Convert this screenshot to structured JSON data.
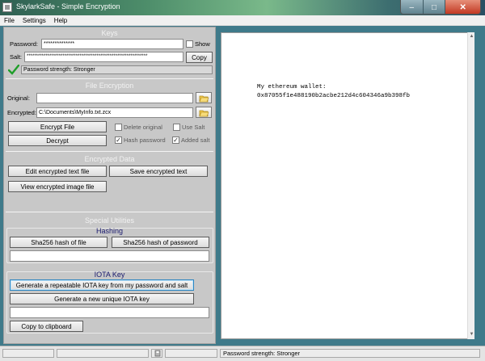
{
  "window": {
    "title": "SkylarkSafe - Simple Encryption",
    "controls": {
      "minimize": "–",
      "maximize": "□",
      "close": "✕"
    }
  },
  "menu": [
    "File",
    "Settings",
    "Help"
  ],
  "keys": {
    "title": "Keys",
    "password_label": "Password:",
    "password_value": "**************",
    "show_label": "Show",
    "salt_label": "Salt:",
    "salt_value": "****************************************************************",
    "copy_button": "Copy",
    "strength_text": "Password strength: Stronger"
  },
  "file_encryption": {
    "title": "File Encryption",
    "original_label": "Original:",
    "original_value": "",
    "encrypted_label": "Encrypted:",
    "encrypted_value": "C:\\Documents\\MyInfo.txt.zcx",
    "encrypt_button": "Encrypt File",
    "decrypt_button": "Decrypt",
    "delete_original": "Delete original",
    "use_salt": "Use Salt",
    "hash_password": "Hash password",
    "added_salt": "Added salt"
  },
  "encrypted_data": {
    "title": "Encrypted Data",
    "edit_text_button": "Edit encrypted text file",
    "save_text_button": "Save encrypted text",
    "view_image_button": "View encrypted image file"
  },
  "special": {
    "title": "Special Utilities",
    "hashing_title": "Hashing",
    "sha_file_button": "Sha256 hash of file",
    "sha_password_button": "Sha256 hash of password",
    "hash_output": "",
    "iota_title": "IOTA Key",
    "iota_repeatable_button": "Generate a repeatable IOTA key from my password and salt",
    "iota_unique_button": "Generate a new unique IOTA key",
    "iota_output": "",
    "copy_clipboard_button": "Copy to clipboard"
  },
  "editor": {
    "text": "My ethereum wallet:\n0x87055f1e488190b2acbe212d4c604346a9b398fb"
  },
  "statusbar": {
    "strength": "Password strength: Stronger"
  },
  "icons": {
    "check": "checkmark-icon",
    "folder": "open-folder-icon",
    "app": "app-icon"
  },
  "state": {
    "show_password": false,
    "delete_original": false,
    "use_salt": false,
    "hash_password": true,
    "added_salt": true
  }
}
